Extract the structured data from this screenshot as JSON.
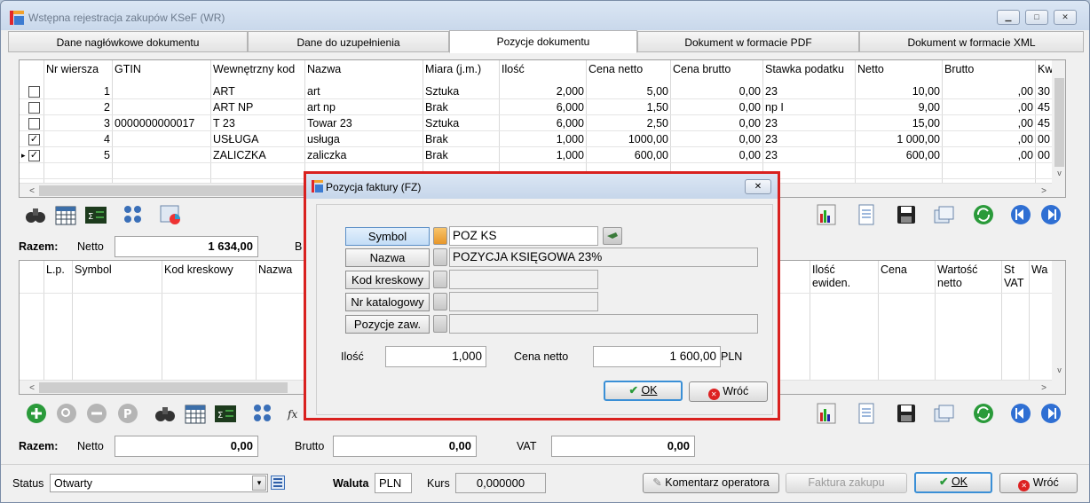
{
  "window": {
    "title": "Wstępna rejestracja zakupów KSeF (WR)"
  },
  "tabs": [
    {
      "label": "Dane nagłówkowe dokumentu"
    },
    {
      "label": "Dane do uzupełnienia"
    },
    {
      "label": "Pozycje dokumentu"
    },
    {
      "label": "Dokument w formacie PDF"
    },
    {
      "label": "Dokument w formacie XML"
    }
  ],
  "upper_grid": {
    "headers": [
      "Nr wiersza",
      "GTIN",
      "Wewnętrzny kod",
      "Nazwa",
      "Miara (j.m.)",
      "Ilość",
      "Cena netto",
      "Cena brutto",
      "Stawka podatku",
      "Netto",
      "Brutto",
      "Kw"
    ],
    "rows": [
      {
        "nr": "1",
        "gtin": "",
        "kod": "ART",
        "nazwa": "art",
        "miara": "Sztuka",
        "ilosc": "2,000",
        "cena_netto": "5,00",
        "cena_brutto": "0,00",
        "stawka": "23",
        "netto": "10,00",
        "brutto": ",00",
        "kw": "30",
        "checked": "",
        "marker": ""
      },
      {
        "nr": "2",
        "gtin": "",
        "kod": "ART NP",
        "nazwa": "art np",
        "miara": "Brak",
        "ilosc": "6,000",
        "cena_netto": "1,50",
        "cena_brutto": "0,00",
        "stawka": "np I",
        "netto": "9,00",
        "brutto": ",00",
        "kw": "45",
        "checked": "",
        "marker": ""
      },
      {
        "nr": "3",
        "gtin": "0000000000017",
        "kod": "T 23",
        "nazwa": "Towar 23",
        "miara": "Sztuka",
        "ilosc": "6,000",
        "cena_netto": "2,50",
        "cena_brutto": "0,00",
        "stawka": "23",
        "netto": "15,00",
        "brutto": ",00",
        "kw": "45",
        "checked": "",
        "marker": ""
      },
      {
        "nr": "4",
        "gtin": "",
        "kod": "USŁUGA",
        "nazwa": "usługa",
        "miara": "Brak",
        "ilosc": "1,000",
        "cena_netto": "1000,00",
        "cena_brutto": "0,00",
        "stawka": "23",
        "netto": "1 000,00",
        "brutto": ",00",
        "kw": "00",
        "checked": "✓",
        "marker": ""
      },
      {
        "nr": "5",
        "gtin": "",
        "kod": "ZALICZKA",
        "nazwa": "zaliczka",
        "miara": "Brak",
        "ilosc": "1,000",
        "cena_netto": "600,00",
        "cena_brutto": "0,00",
        "stawka": "23",
        "netto": "600,00",
        "brutto": ",00",
        "kw": "00",
        "checked": "✓",
        "marker": "▸"
      }
    ]
  },
  "upper_totals": {
    "razem": "Razem:",
    "netto_label": "Netto",
    "netto": "1 634,00",
    "brutto_label": "B"
  },
  "lower_grid": {
    "headers": [
      "L.p.",
      "Symbol",
      "Kod kreskowy",
      "Nazwa",
      "Ilość ewiden.",
      "Cena",
      "Wartość netto",
      "St VAT",
      "Wa"
    ]
  },
  "lower_totals": {
    "razem": "Razem:",
    "netto_label": "Netto",
    "netto": "0,00",
    "brutto_label": "Brutto",
    "brutto": "0,00",
    "vat_label": "VAT",
    "vat": "0,00"
  },
  "footer": {
    "status_label": "Status",
    "status_value": "Otwarty",
    "waluta_label": "Waluta",
    "waluta_value": "PLN",
    "kurs_label": "Kurs",
    "kurs_value": "0,000000",
    "komentarz": "Komentarz operatora",
    "faktura": "Faktura zakupu",
    "ok": "OK",
    "wroc": "Wróć"
  },
  "dialog": {
    "title": "Pozycja faktury (FZ)",
    "symbol_label": "Symbol",
    "symbol_value": "POZ KS",
    "nazwa_label": "Nazwa",
    "nazwa_value": "POZYCJA KSIĘGOWA 23%",
    "kod_label": "Kod kreskowy",
    "kod_value": "",
    "nrkat_label": "Nr katalogowy",
    "nrkat_value": "",
    "pozzaw_label": "Pozycje zaw.",
    "pozzaw_value": "",
    "ilosc_label": "Ilość",
    "ilosc_value": "1,000",
    "cena_label": "Cena netto",
    "cena_value": "1 600,00",
    "currency": "PLN",
    "ok": "OK",
    "wroc": "Wróć"
  },
  "colors": {
    "accent": "#3a8fd6",
    "dialog_border": "#d9211f",
    "nav_blue": "#2f6fd3",
    "refresh_green": "#2a9a3a"
  }
}
